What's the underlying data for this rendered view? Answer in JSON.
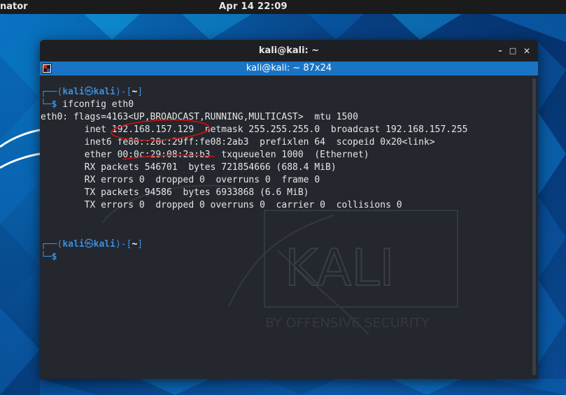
{
  "topbar": {
    "app_menu": "nator",
    "clock": "Apr 14  22:09"
  },
  "window": {
    "title": "kali@kali: ~",
    "minimize_glyph": "–",
    "maximize_glyph": "□",
    "close_glyph": "✕",
    "tab_title": "kali@kali: ~ 87x24"
  },
  "terminal": {
    "prompt1_open": "┌──(",
    "prompt_user": "kali",
    "prompt_at": "㉿",
    "prompt_host": "kali",
    "prompt_close": ")-[",
    "prompt_dir": "~",
    "prompt_end": "]",
    "prompt2": "└─",
    "prompt_symbol": "$",
    "command": " ifconfig eth0",
    "output": [
      "eth0: flags=4163<UP,BROADCAST,RUNNING,MULTICAST>  mtu 1500",
      "        inet 192.168.157.129  netmask 255.255.255.0  broadcast 192.168.157.255",
      "        inet6 fe80::20c:29ff:fe08:2ab3  prefixlen 64  scopeid 0x20<link>",
      "        ether 00:0c:29:08:2a:b3  txqueuelen 1000  (Ethernet)",
      "        RX packets 546701  bytes 721854666 (688.4 MiB)",
      "        RX errors 0  dropped 0  overruns 0  frame 0",
      "        TX packets 94586  bytes 6933868 (6.6 MiB)",
      "        TX errors 0  dropped 0 overruns 0  carrier 0  collisions 0"
    ],
    "watermark_logo": "KALI",
    "watermark_tagline": "BY OFFENSIVE SECURITY"
  },
  "colors": {
    "accent": "#1a74c4",
    "prompt": "#3d8fe0",
    "annotation": "#d01010",
    "terminal_bg": "#24272d"
  }
}
